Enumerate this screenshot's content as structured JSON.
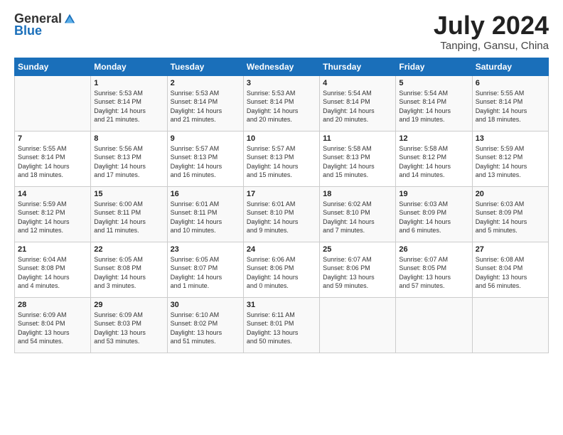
{
  "header": {
    "logo_general": "General",
    "logo_blue": "Blue",
    "title": "July 2024",
    "location": "Tanping, Gansu, China"
  },
  "days_header": [
    "Sunday",
    "Monday",
    "Tuesday",
    "Wednesday",
    "Thursday",
    "Friday",
    "Saturday"
  ],
  "weeks": [
    [
      {
        "day": "",
        "info": ""
      },
      {
        "day": "1",
        "info": "Sunrise: 5:53 AM\nSunset: 8:14 PM\nDaylight: 14 hours\nand 21 minutes."
      },
      {
        "day": "2",
        "info": "Sunrise: 5:53 AM\nSunset: 8:14 PM\nDaylight: 14 hours\nand 21 minutes."
      },
      {
        "day": "3",
        "info": "Sunrise: 5:53 AM\nSunset: 8:14 PM\nDaylight: 14 hours\nand 20 minutes."
      },
      {
        "day": "4",
        "info": "Sunrise: 5:54 AM\nSunset: 8:14 PM\nDaylight: 14 hours\nand 20 minutes."
      },
      {
        "day": "5",
        "info": "Sunrise: 5:54 AM\nSunset: 8:14 PM\nDaylight: 14 hours\nand 19 minutes."
      },
      {
        "day": "6",
        "info": "Sunrise: 5:55 AM\nSunset: 8:14 PM\nDaylight: 14 hours\nand 18 minutes."
      }
    ],
    [
      {
        "day": "7",
        "info": "Sunrise: 5:55 AM\nSunset: 8:14 PM\nDaylight: 14 hours\nand 18 minutes."
      },
      {
        "day": "8",
        "info": "Sunrise: 5:56 AM\nSunset: 8:13 PM\nDaylight: 14 hours\nand 17 minutes."
      },
      {
        "day": "9",
        "info": "Sunrise: 5:57 AM\nSunset: 8:13 PM\nDaylight: 14 hours\nand 16 minutes."
      },
      {
        "day": "10",
        "info": "Sunrise: 5:57 AM\nSunset: 8:13 PM\nDaylight: 14 hours\nand 15 minutes."
      },
      {
        "day": "11",
        "info": "Sunrise: 5:58 AM\nSunset: 8:13 PM\nDaylight: 14 hours\nand 15 minutes."
      },
      {
        "day": "12",
        "info": "Sunrise: 5:58 AM\nSunset: 8:12 PM\nDaylight: 14 hours\nand 14 minutes."
      },
      {
        "day": "13",
        "info": "Sunrise: 5:59 AM\nSunset: 8:12 PM\nDaylight: 14 hours\nand 13 minutes."
      }
    ],
    [
      {
        "day": "14",
        "info": "Sunrise: 5:59 AM\nSunset: 8:12 PM\nDaylight: 14 hours\nand 12 minutes."
      },
      {
        "day": "15",
        "info": "Sunrise: 6:00 AM\nSunset: 8:11 PM\nDaylight: 14 hours\nand 11 minutes."
      },
      {
        "day": "16",
        "info": "Sunrise: 6:01 AM\nSunset: 8:11 PM\nDaylight: 14 hours\nand 10 minutes."
      },
      {
        "day": "17",
        "info": "Sunrise: 6:01 AM\nSunset: 8:10 PM\nDaylight: 14 hours\nand 9 minutes."
      },
      {
        "day": "18",
        "info": "Sunrise: 6:02 AM\nSunset: 8:10 PM\nDaylight: 14 hours\nand 7 minutes."
      },
      {
        "day": "19",
        "info": "Sunrise: 6:03 AM\nSunset: 8:09 PM\nDaylight: 14 hours\nand 6 minutes."
      },
      {
        "day": "20",
        "info": "Sunrise: 6:03 AM\nSunset: 8:09 PM\nDaylight: 14 hours\nand 5 minutes."
      }
    ],
    [
      {
        "day": "21",
        "info": "Sunrise: 6:04 AM\nSunset: 8:08 PM\nDaylight: 14 hours\nand 4 minutes."
      },
      {
        "day": "22",
        "info": "Sunrise: 6:05 AM\nSunset: 8:08 PM\nDaylight: 14 hours\nand 3 minutes."
      },
      {
        "day": "23",
        "info": "Sunrise: 6:05 AM\nSunset: 8:07 PM\nDaylight: 14 hours\nand 1 minute."
      },
      {
        "day": "24",
        "info": "Sunrise: 6:06 AM\nSunset: 8:06 PM\nDaylight: 14 hours\nand 0 minutes."
      },
      {
        "day": "25",
        "info": "Sunrise: 6:07 AM\nSunset: 8:06 PM\nDaylight: 13 hours\nand 59 minutes."
      },
      {
        "day": "26",
        "info": "Sunrise: 6:07 AM\nSunset: 8:05 PM\nDaylight: 13 hours\nand 57 minutes."
      },
      {
        "day": "27",
        "info": "Sunrise: 6:08 AM\nSunset: 8:04 PM\nDaylight: 13 hours\nand 56 minutes."
      }
    ],
    [
      {
        "day": "28",
        "info": "Sunrise: 6:09 AM\nSunset: 8:04 PM\nDaylight: 13 hours\nand 54 minutes."
      },
      {
        "day": "29",
        "info": "Sunrise: 6:09 AM\nSunset: 8:03 PM\nDaylight: 13 hours\nand 53 minutes."
      },
      {
        "day": "30",
        "info": "Sunrise: 6:10 AM\nSunset: 8:02 PM\nDaylight: 13 hours\nand 51 minutes."
      },
      {
        "day": "31",
        "info": "Sunrise: 6:11 AM\nSunset: 8:01 PM\nDaylight: 13 hours\nand 50 minutes."
      },
      {
        "day": "",
        "info": ""
      },
      {
        "day": "",
        "info": ""
      },
      {
        "day": "",
        "info": ""
      }
    ]
  ]
}
